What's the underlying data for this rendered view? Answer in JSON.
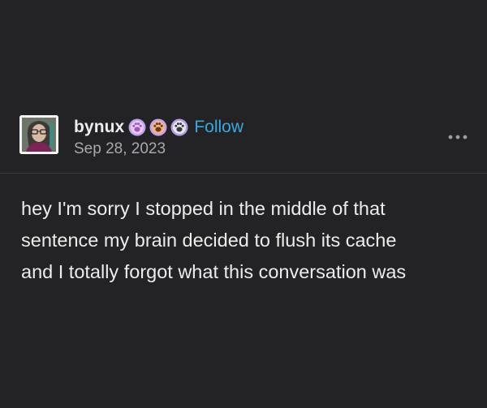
{
  "post": {
    "username": "bynux",
    "follow_label": "Follow",
    "date": "Sep 28, 2023",
    "badges": [
      "paw-print-badge",
      "paw-print-badge",
      "paw-print-badge"
    ],
    "body_lines": [
      "hey I'm sorry I stopped in the middle of that",
      "sentence my brain decided to flush its cache",
      "and I totally forgot what this conversation was"
    ]
  },
  "colors": {
    "background": "#232325",
    "text": "#ececec",
    "muted_text": "#a9a9ac",
    "follow_link": "#3aa8e0",
    "divider": "#3a3a3d"
  },
  "icons": {
    "more": "more-options-icon",
    "avatar": "user-avatar"
  }
}
